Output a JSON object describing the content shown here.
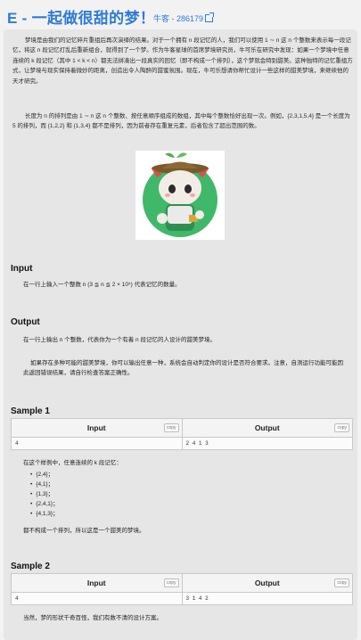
{
  "header": {
    "title": "E - 一起做很甜的梦！",
    "source": "牛客 - 286179"
  },
  "statement": {
    "para1": "梦境是由我们的记忆碎片重组后再次演绎的结果。对于一个拥有 n 段记忆的人，我们可以使用 1 ∼ n 这 n 个整数来表示每一段记忆，将这 n 段记忆打乱后重新组合，就得到了一个梦。作为牛客星球的首席梦境研究员，牛可乐在研究中发现：如果一个梦境中任意连续的 k 段记忆（其中 1 < k < n）都无法拼凑出一段真实的回忆（即不构成一个排列），这个梦就会特别甜美。这种独特的记忆重组方式，让梦境与现实保持着微妙的距离，创造出令人陶醉的甜蜜氛围。现在，牛可乐想请你帮忙设计一些这样的甜美梦境，来继续他的天才研究。",
    "para2": "长度为 n 的排列是由 1 ∼ n 这 n 个整数、按任意顺序组成的数组，其中每个整数恰好出现一次。例如，{2,3,1,5,4} 是一个长度为 5 的排列，而 {1,2,2} 和 {1,3,4} 都不是排列，因为前者存在重复元素，后者包含了超出范围的数。"
  },
  "input": {
    "heading": "Input",
    "text": "在一行上输入一个整数 n (3 ≦ n ≦ 2 × 10⁵) 代表记忆的数量。"
  },
  "output": {
    "heading": "Output",
    "text1": "在一行上输出 n 个整数，代表你为一个有着 n 段记忆的人设计的甜美梦境。",
    "text2": "如果存在多种可能的甜美梦境，你可以输出任意一种，系统会自动判定你的设计是否符合要求。注意，自测运行功能可能因此返回错误结果，请自行检查答案正确性。"
  },
  "sample1": {
    "heading": "Sample 1",
    "input_label": "Input",
    "output_label": "Output",
    "copy": "copy",
    "input": "4",
    "output": "2 4 1 3",
    "note_intro": "在这个样例中，任意连续的 k 段记忆：",
    "items": [
      "{2,4}；",
      "{4,1}；",
      "{1,3}；",
      "{2,4,1}；",
      "{4,1,3}；"
    ],
    "note_end": "都不构成一个排列，所以这是一个甜美的梦境。"
  },
  "sample2": {
    "heading": "Sample 2",
    "input_label": "Input",
    "output_label": "Output",
    "copy": "copy",
    "input": "4",
    "output": "3 1 4 2",
    "note": "当然，梦的形状千奇百怪，我们有数不清的设计方案。"
  }
}
